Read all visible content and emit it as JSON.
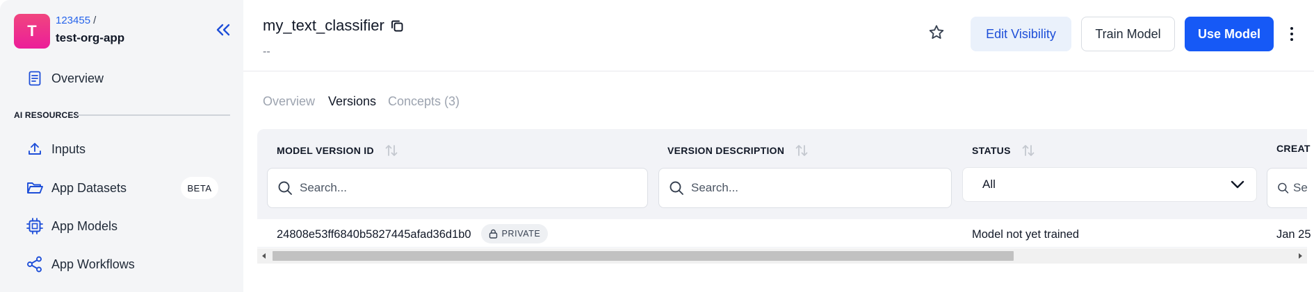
{
  "sidebar": {
    "org_initial": "T",
    "org_id": "123455",
    "org_separator": "/",
    "app_name": "test-org-app",
    "overview_label": "Overview",
    "section_label": "AI RESOURCES",
    "items": [
      {
        "label": "Inputs",
        "icon": "upload-icon"
      },
      {
        "label": "App Datasets",
        "icon": "folder-icon",
        "badge": "BETA"
      },
      {
        "label": "App Models",
        "icon": "chip-icon"
      },
      {
        "label": "App Workflows",
        "icon": "share-nodes-icon"
      }
    ],
    "accent_color": "#1d4ed8",
    "avatar_colors": [
      "#f0457f",
      "#ec1e99"
    ]
  },
  "header": {
    "title": "my_text_classifier",
    "description": "--",
    "buttons": {
      "edit_visibility": "Edit Visibility",
      "train_model": "Train Model",
      "use_model": "Use Model"
    },
    "primary_color": "#1659f6"
  },
  "tabs": [
    {
      "label": "Overview",
      "active": false
    },
    {
      "label": "Versions",
      "active": true
    },
    {
      "label": "Concepts (3)",
      "active": false
    }
  ],
  "table": {
    "columns": [
      {
        "label": "MODEL VERSION ID",
        "filter": "search",
        "placeholder": "Search..."
      },
      {
        "label": "VERSION DESCRIPTION",
        "filter": "search",
        "placeholder": "Search..."
      },
      {
        "label": "STATUS",
        "filter": "select",
        "selected": "All"
      },
      {
        "label": "CREAT",
        "filter": "search",
        "placeholder": "Se"
      }
    ],
    "rows": [
      {
        "version_id": "24808e53ff6840b5827445afad36d1b0",
        "visibility": "PRIVATE",
        "description": "",
        "status": "Model not yet trained",
        "created": "Jan 25"
      }
    ]
  }
}
